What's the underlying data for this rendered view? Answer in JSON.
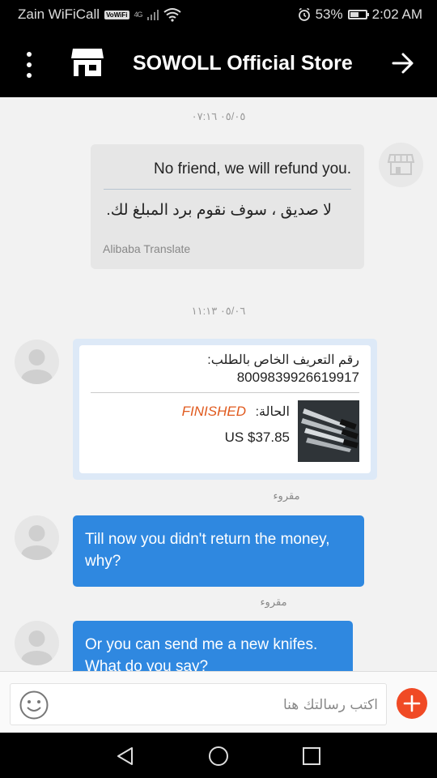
{
  "status_bar": {
    "carrier": "Zain WiFiCall",
    "vowifi": "VoWiFi",
    "signal": "4G",
    "battery_percent": "53%",
    "battery_level": 0.53,
    "time": "2:02 AM"
  },
  "header": {
    "title": "SOWOLL Official Store",
    "menu_icon": "more-vertical-icon",
    "store_icon": "store-icon",
    "forward_icon": "arrow-right-icon"
  },
  "chat": {
    "messages": [
      {
        "timestamp": "٠٥/٠٥ ٠٧:١٦",
        "text": "No friend, we will refund you.",
        "translation": "لا صديق ، سوف نقوم برد المبلغ لك.",
        "translation_credit": "Alibaba Translate"
      },
      {
        "timestamp": "٠٥/٠٦ ١١:١٣",
        "order": {
          "id_label": "رقم التعريف الخاص بالطلب:",
          "id_value": "8009839926619917",
          "status_label": "الحالة:",
          "status_value": "FINISHED",
          "price": "US $37.85"
        },
        "read_label": "مقروء"
      },
      {
        "text": "Till now you didn't return the money, why?",
        "read_label": "مقروء"
      },
      {
        "text": "Or you can send  me a new knifes. What do you say?"
      }
    ]
  },
  "composer": {
    "placeholder": "اكتب رسالتك هنا",
    "emoji_icon": "emoji-icon",
    "add_icon": "plus-icon"
  },
  "nav_bar": {
    "back_icon": "back-triangle-icon",
    "home_icon": "home-circle-icon",
    "recents_icon": "recents-square-icon"
  },
  "colors": {
    "accent_blue": "#2f88e0",
    "status_orange": "#e05a1e",
    "add_button_red": "#f04a25"
  }
}
